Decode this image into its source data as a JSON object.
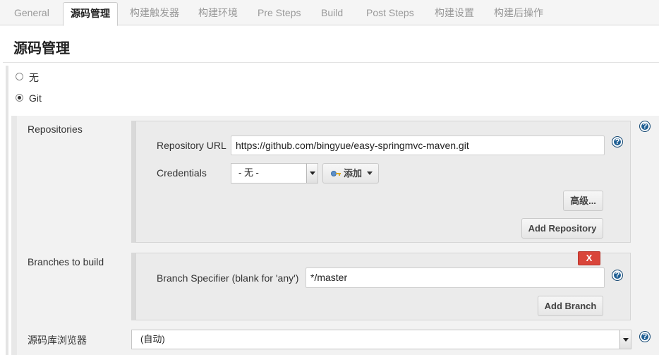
{
  "tabs": [
    {
      "label": "General"
    },
    {
      "label": "源码管理"
    },
    {
      "label": "构建触发器"
    },
    {
      "label": "构建环境"
    },
    {
      "label": "Pre Steps"
    },
    {
      "label": "Build"
    },
    {
      "label": "Post Steps"
    },
    {
      "label": "构建设置"
    },
    {
      "label": "构建后操作"
    }
  ],
  "section": {
    "title": "源码管理"
  },
  "scm": {
    "options": [
      {
        "label": "无",
        "selected": false
      },
      {
        "label": "Git",
        "selected": true
      }
    ]
  },
  "repositories": {
    "label": "Repositories",
    "url_label": "Repository URL",
    "url_value": "https://github.com/bingyue/easy-springmvc-maven.git",
    "credentials_label": "Credentials",
    "credentials_value": "- 无 -",
    "add_label": "添加",
    "advanced_label": "高级...",
    "add_repository_label": "Add Repository"
  },
  "branches": {
    "label": "Branches to build",
    "delete_label": "X",
    "specifier_label": "Branch Specifier (blank for 'any')",
    "specifier_value": "*/master",
    "add_branch_label": "Add Branch"
  },
  "browser": {
    "label": "源码库浏览器",
    "value": "(自动)"
  },
  "help_symbol": "?",
  "colors": {
    "help_icon": "#1f5f94",
    "delete_button": "#d9453a",
    "key_icon": "#5b8fc9"
  }
}
